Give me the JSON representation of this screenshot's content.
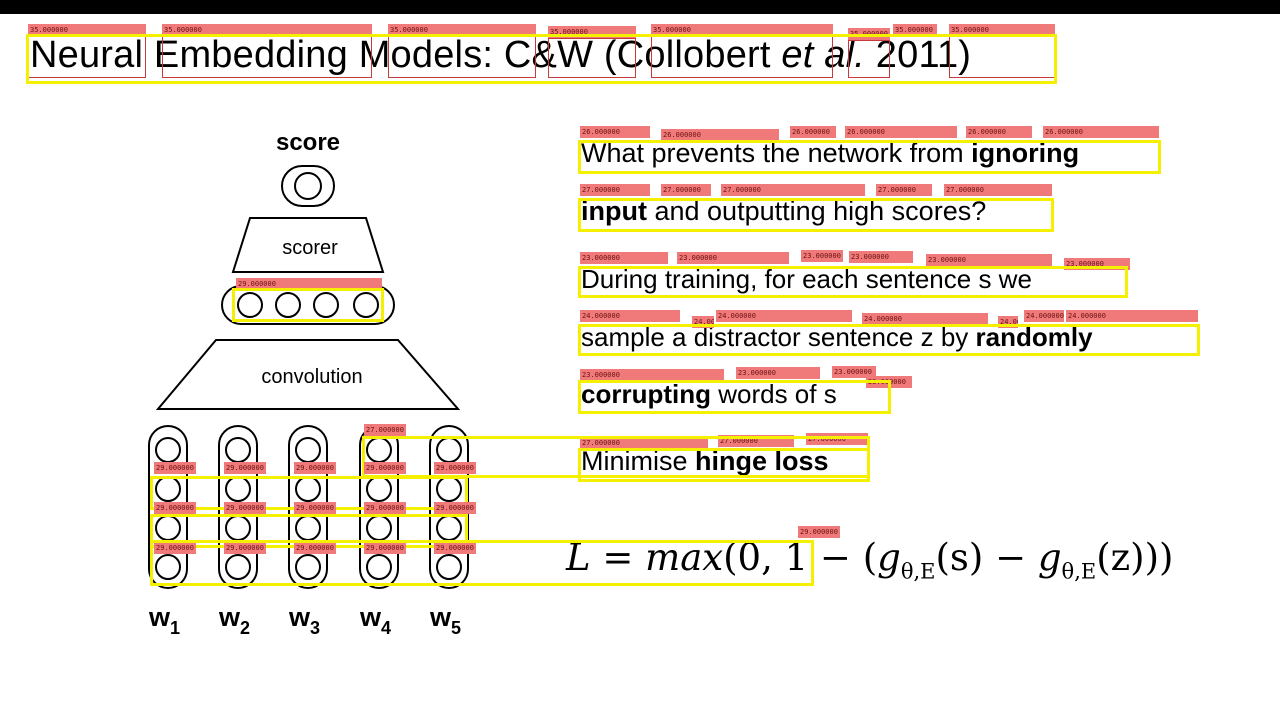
{
  "slide": {
    "title": {
      "main": "Neural Embedding Models: C&W (Collobert ",
      "et": "et",
      "space": " ",
      "al": "al.",
      "year": " 2011)"
    },
    "lines": {
      "l1_a": "What prevents the network from ",
      "l1_b": "ignoring",
      "l2_a": "input",
      "l2_b": " and outputting high scores?",
      "l3": "During training, for each sentence s we",
      "l4_a": "sample a distractor sentence z by ",
      "l4_b": "randomly",
      "l5_a": "corrupting",
      "l5_b": " words of s",
      "l6_a": "Minimise ",
      "l6_b": "hinge loss"
    },
    "formula": {
      "lhs": "L",
      "eq": " = ",
      "max": "max",
      "args_open": "(0, 1 − (",
      "g1": "g",
      "sub1": "θ,E",
      "arg1": "(s) − ",
      "g2": "g",
      "sub2": "θ,E",
      "arg2": "(z)))"
    }
  },
  "diagram": {
    "score_label": "score",
    "scorer_label": "scorer",
    "convolution_label": "convolution",
    "words": [
      {
        "base": "w",
        "sub": "1"
      },
      {
        "base": "w",
        "sub": "2"
      },
      {
        "base": "w",
        "sub": "3"
      },
      {
        "base": "w",
        "sub": "4"
      },
      {
        "base": "w",
        "sub": "5"
      }
    ]
  },
  "annotations": {
    "tag_35": "35.000000",
    "tag_29": "29.000000",
    "tag_27": "27.000000",
    "tag_26": "26.000000",
    "tag_24": "24.000000",
    "tag_23": "23.000000"
  },
  "colors": {
    "ocr_box": "#f4f000",
    "ocr_tag": "#f07a7a",
    "word_outline": "#c83a3a"
  }
}
